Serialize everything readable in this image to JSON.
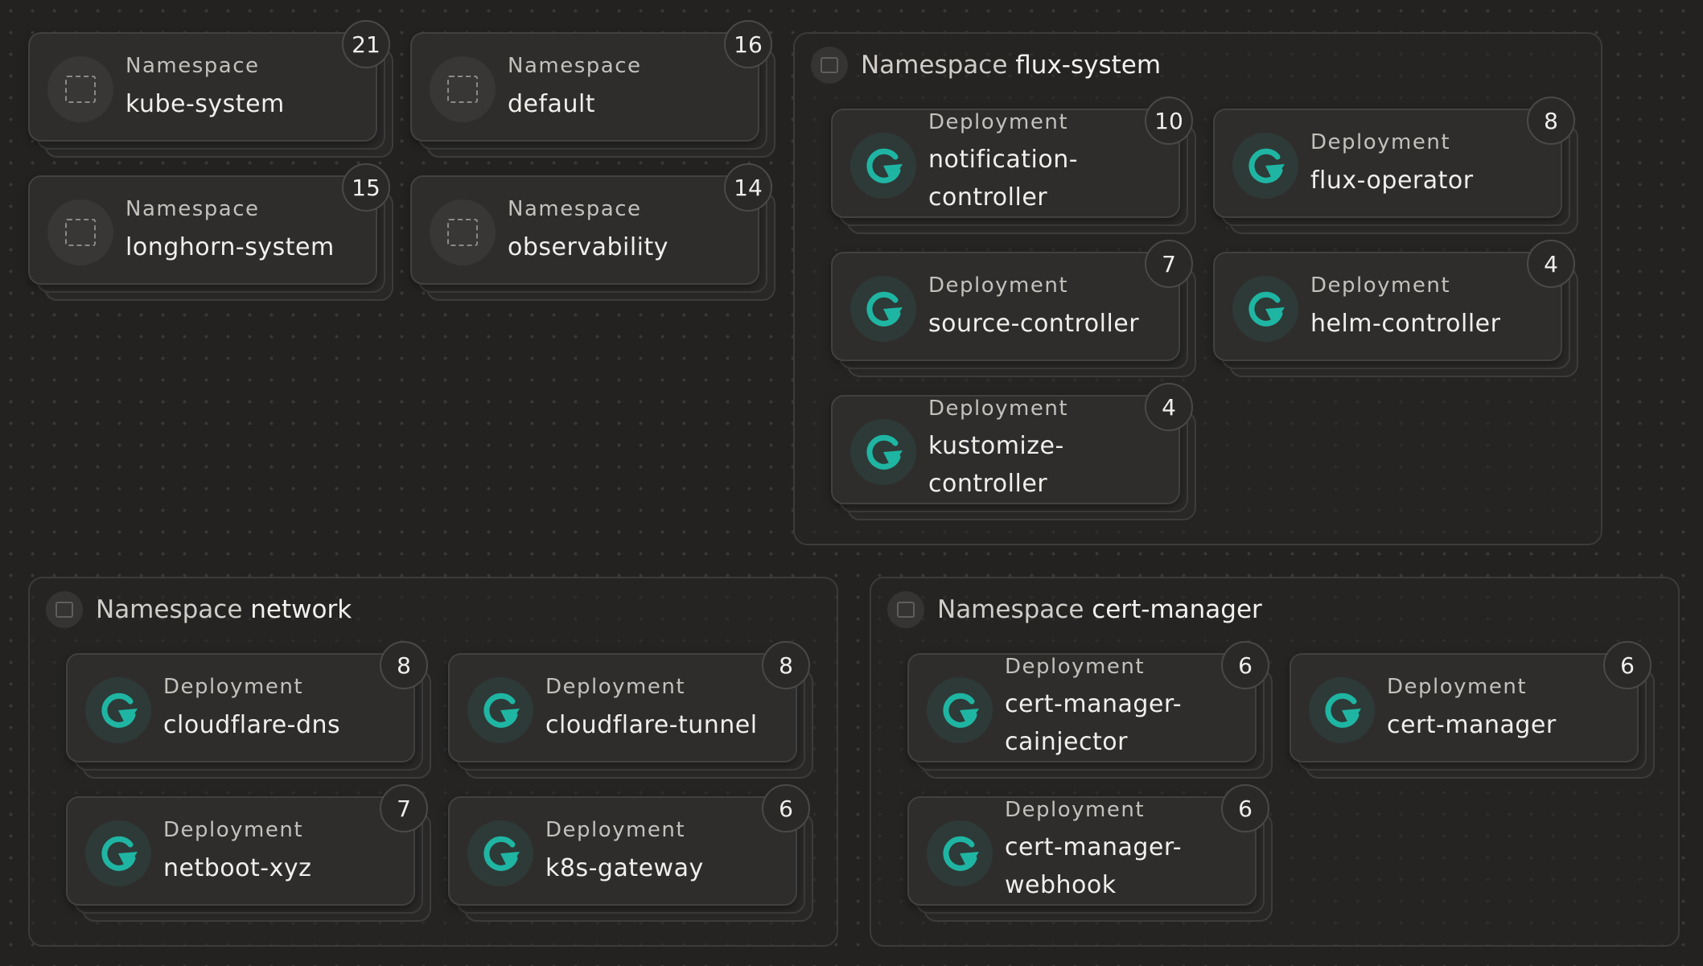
{
  "colors": {
    "accent": "#1fb5a3",
    "background": "#232221",
    "card": "#2e2d2c"
  },
  "namespace_cards": [
    {
      "kind": "Namespace",
      "name": "kube-system",
      "count": "21",
      "icon": "namespace-icon"
    },
    {
      "kind": "Namespace",
      "name": "default",
      "count": "16",
      "icon": "namespace-icon"
    },
    {
      "kind": "Namespace",
      "name": "longhorn-system",
      "count": "15",
      "icon": "namespace-icon"
    },
    {
      "kind": "Namespace",
      "name": "observability",
      "count": "14",
      "icon": "namespace-icon"
    }
  ],
  "groups": {
    "flux": {
      "label": "Namespace",
      "name": "flux-system",
      "deployments": [
        {
          "kind": "Deployment",
          "name_line1": "notification-",
          "name_line2": "controller",
          "count": "10"
        },
        {
          "kind": "Deployment",
          "name": "flux-operator",
          "count": "8"
        },
        {
          "kind": "Deployment",
          "name": "source-controller",
          "count": "7"
        },
        {
          "kind": "Deployment",
          "name": "helm-controller",
          "count": "4"
        },
        {
          "kind": "Deployment",
          "name_line1": "kustomize-",
          "name_line2": "controller",
          "count": "4"
        }
      ]
    },
    "network": {
      "label": "Namespace",
      "name": "network",
      "deployments": [
        {
          "kind": "Deployment",
          "name": "cloudflare-dns",
          "count": "8"
        },
        {
          "kind": "Deployment",
          "name": "cloudflare-tunnel",
          "count": "8"
        },
        {
          "kind": "Deployment",
          "name": "netboot-xyz",
          "count": "7"
        },
        {
          "kind": "Deployment",
          "name": "k8s-gateway",
          "count": "6"
        }
      ]
    },
    "certmanager": {
      "label": "Namespace",
      "name": "cert-manager",
      "deployments": [
        {
          "kind": "Deployment",
          "name_line1": "cert-manager-",
          "name_line2": "cainjector",
          "count": "6"
        },
        {
          "kind": "Deployment",
          "name": "cert-manager",
          "count": "6"
        },
        {
          "kind": "Deployment",
          "name_line1": "cert-manager-",
          "name_line2": "webhook",
          "count": "6"
        }
      ]
    }
  },
  "icons": {
    "namespace": "namespace-icon",
    "deployment": "deployment-refresh-icon",
    "group": "group-square-icon"
  }
}
